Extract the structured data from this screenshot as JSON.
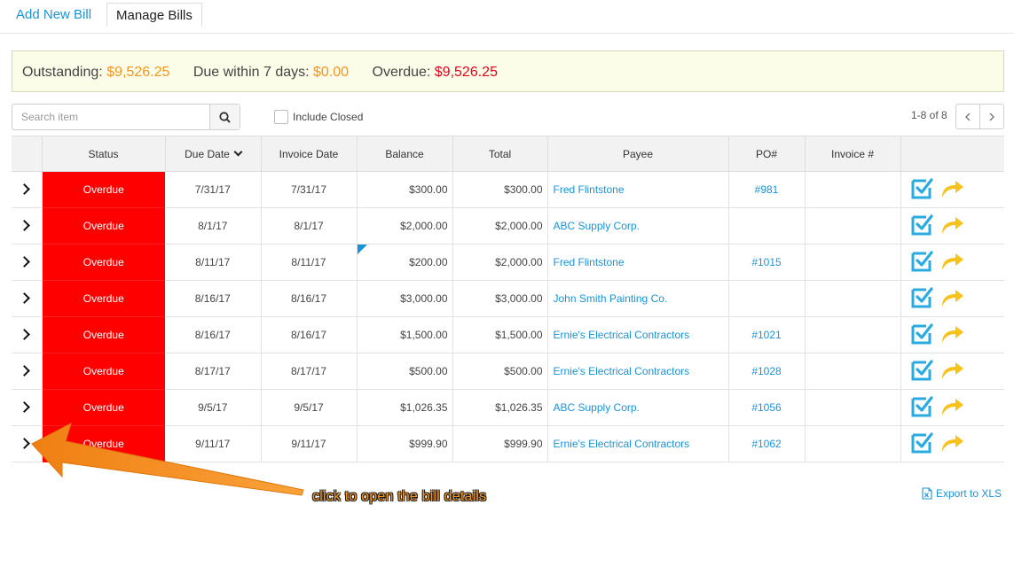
{
  "tabs": {
    "add_new": "Add New Bill",
    "manage": "Manage Bills"
  },
  "summary": {
    "outstanding_label": "Outstanding:",
    "outstanding_value": "$9,526.25",
    "due7_label": "Due within 7 days:",
    "due7_value": "$0.00",
    "overdue_label": "Overdue:",
    "overdue_value": "$9,526.25"
  },
  "search": {
    "placeholder": "Search item",
    "icon": "search-icon"
  },
  "filter": {
    "include_closed": "Include Closed"
  },
  "pager": {
    "range": "1-8 of 8"
  },
  "table": {
    "headers": {
      "status": "Status",
      "due_date": "Due Date",
      "invoice_date": "Invoice Date",
      "balance": "Balance",
      "total": "Total",
      "payee": "Payee",
      "po": "PO#",
      "invoice": "Invoice #"
    },
    "rows": [
      {
        "status": "Overdue",
        "due_date": "7/31/17",
        "invoice_date": "7/31/17",
        "balance": "$300.00",
        "total": "$300.00",
        "payee": "Fred Flintstone",
        "po": "#981",
        "invoice": ""
      },
      {
        "status": "Overdue",
        "due_date": "8/1/17",
        "invoice_date": "8/1/17",
        "balance": "$2,000.00",
        "total": "$2,000.00",
        "payee": "ABC Supply Corp.",
        "po": "",
        "invoice": ""
      },
      {
        "status": "Overdue",
        "due_date": "8/11/17",
        "invoice_date": "8/11/17",
        "balance": "$200.00",
        "total": "$2,000.00",
        "payee": "Fred Flintstone",
        "po": "#1015",
        "invoice": ""
      },
      {
        "status": "Overdue",
        "due_date": "8/16/17",
        "invoice_date": "8/16/17",
        "balance": "$3,000.00",
        "total": "$3,000.00",
        "payee": "John Smith Painting Co.",
        "po": "",
        "invoice": ""
      },
      {
        "status": "Overdue",
        "due_date": "8/16/17",
        "invoice_date": "8/16/17",
        "balance": "$1,500.00",
        "total": "$1,500.00",
        "payee": "Ernie's Electrical Contractors",
        "po": "#1021",
        "invoice": ""
      },
      {
        "status": "Overdue",
        "due_date": "8/17/17",
        "invoice_date": "8/17/17",
        "balance": "$500.00",
        "total": "$500.00",
        "payee": "Ernie's Electrical Contractors",
        "po": "#1028",
        "invoice": ""
      },
      {
        "status": "Overdue",
        "due_date": "9/5/17",
        "invoice_date": "9/5/17",
        "balance": "$1,026.35",
        "total": "$1,026.35",
        "payee": "ABC Supply Corp.",
        "po": "#1056",
        "invoice": ""
      },
      {
        "status": "Overdue",
        "due_date": "9/11/17",
        "invoice_date": "9/11/17",
        "balance": "$999.90",
        "total": "$999.90",
        "payee": "Ernie's Electrical Contractors",
        "po": "#1062",
        "invoice": ""
      }
    ]
  },
  "export": {
    "label": "Export to XLS",
    "icon": "excel-file-icon"
  },
  "annotation": {
    "text": "click to open the bill details"
  },
  "colors": {
    "link": "#1a93d6",
    "overdue_bg": "#ff0000",
    "orange": "#f7941d",
    "red": "#e8001b",
    "approve_icon": "#29abe2",
    "forward_icon": "#f7c21c"
  }
}
